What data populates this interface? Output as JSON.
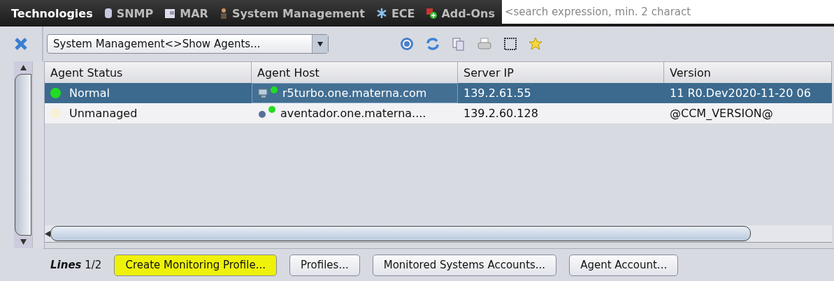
{
  "menu": [
    {
      "label": "Technologies"
    },
    {
      "label": "SNMP"
    },
    {
      "label": "MAR"
    },
    {
      "label": "System Management"
    },
    {
      "label": "ECE"
    },
    {
      "label": "Add-Ons"
    }
  ],
  "search": {
    "placeholder": "<search expression, min. 2 charact"
  },
  "view_select": {
    "value": "System Management<>Show Agents..."
  },
  "table": {
    "columns": [
      "Agent Status",
      "Agent Host",
      "Server IP",
      "Version"
    ],
    "rows": [
      {
        "selected": true,
        "status": "Normal",
        "color": "#22dd22",
        "host": "r5turbo.one.materna.com",
        "server_ip": "139.2.61.55",
        "version": "11 R0.Dev2020-11-20 06"
      },
      {
        "selected": false,
        "status": "Unmanaged",
        "color": "#f7f0d4",
        "host": "aventador.one.materna....",
        "server_ip": "139.2.60.128",
        "version": "@CCM_VERSION@"
      }
    ]
  },
  "footer": {
    "lines_label": "Lines",
    "lines_value": "1/2",
    "buttons": [
      {
        "label": "Create Monitoring Profile...",
        "highlighted": true
      },
      {
        "label": "Profiles...",
        "highlighted": false
      },
      {
        "label": "Monitored Systems Accounts...",
        "highlighted": false
      },
      {
        "label": "Agent Account...",
        "highlighted": false
      }
    ]
  }
}
